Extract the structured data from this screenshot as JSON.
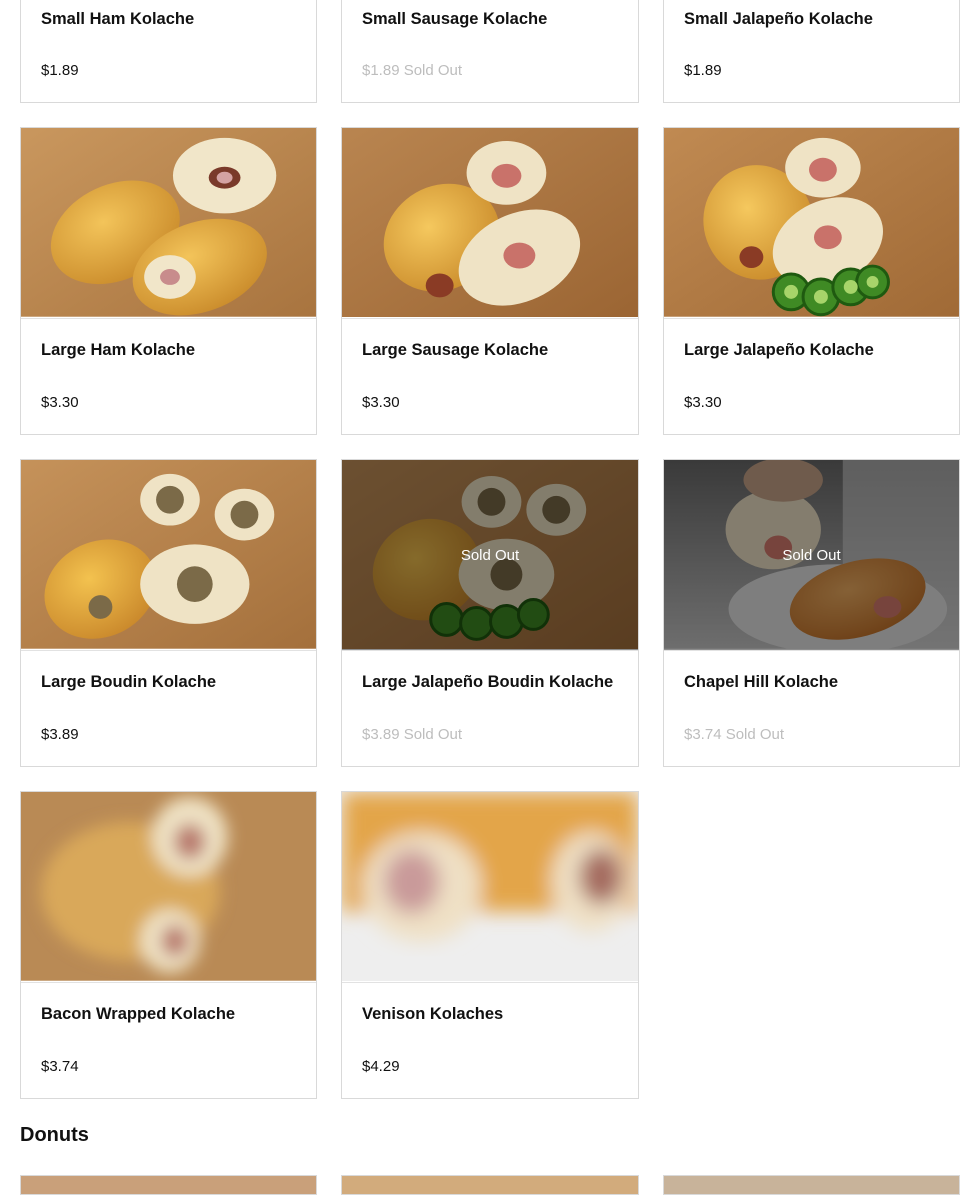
{
  "menu": {
    "items": [
      {
        "name": "Small Ham Kolache",
        "price": "$1.89",
        "sold_out": false,
        "image": null
      },
      {
        "name": "Small Sausage Kolache",
        "price": "$1.89 Sold Out",
        "sold_out": true,
        "image": null
      },
      {
        "name": "Small Jalapeño Kolache",
        "price": "$1.89",
        "sold_out": false,
        "image": null
      },
      {
        "name": "Large Ham Kolache",
        "price": "$3.30",
        "sold_out": false,
        "image": "ham-kolache-photo"
      },
      {
        "name": "Large Sausage Kolache",
        "price": "$3.30",
        "sold_out": false,
        "image": "sausage-kolache-photo"
      },
      {
        "name": "Large Jalapeño Kolache",
        "price": "$3.30",
        "sold_out": false,
        "image": "jalapeno-kolache-photo"
      },
      {
        "name": "Large Boudin Kolache",
        "price": "$3.89",
        "sold_out": false,
        "image": "boudin-kolache-photo"
      },
      {
        "name": "Large Jalapeño Boudin Kolache",
        "price": "$3.89 Sold Out",
        "sold_out": true,
        "image": "jalapeno-boudin-kolache-photo",
        "overlay": "Sold Out"
      },
      {
        "name": "Chapel Hill Kolache",
        "price": "$3.74 Sold Out",
        "sold_out": true,
        "image": "chapel-hill-kolache-photo",
        "overlay": "Sold Out"
      },
      {
        "name": "Bacon Wrapped Kolache",
        "price": "$3.74",
        "sold_out": false,
        "image": "bacon-wrapped-kolache-photo-blurred"
      },
      {
        "name": "Venison Kolaches",
        "price": "$4.29",
        "sold_out": false,
        "image": "venison-kolache-photo-blurred"
      }
    ]
  },
  "donuts": {
    "title": "Donuts"
  },
  "colors": {
    "sold_out_text": "#bdbdbd",
    "card_border": "#d9d9d9",
    "wood": "#b9864f"
  }
}
